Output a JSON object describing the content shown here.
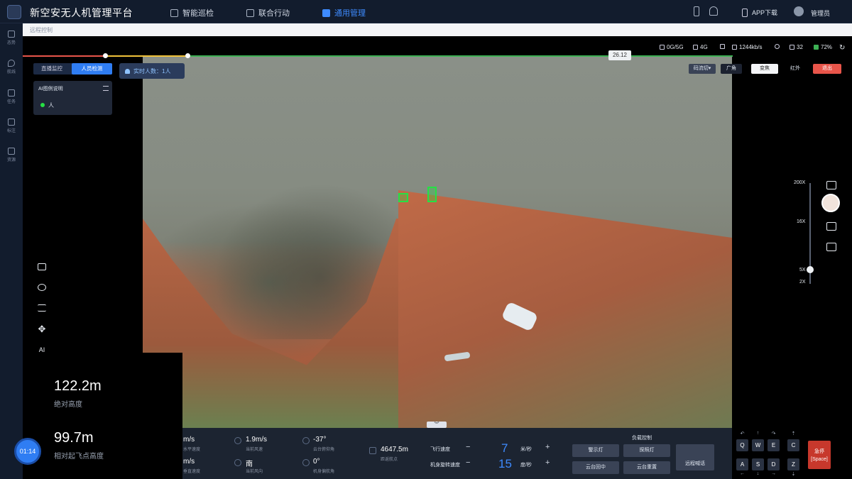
{
  "app": {
    "title": "新空安无人机管理平台"
  },
  "nav": {
    "items": [
      {
        "label": "智能巡检"
      },
      {
        "label": "联合行动"
      },
      {
        "label": "通用管理"
      }
    ],
    "app_download": "APP下载",
    "user": "管理员"
  },
  "breadcrumb": "远程控制",
  "sidebar": {
    "items": [
      {
        "label": "态势"
      },
      {
        "label": "航线"
      },
      {
        "label": "任务"
      },
      {
        "label": "标注"
      },
      {
        "label": "资源"
      }
    ]
  },
  "playback": {
    "time_tip": "26.12",
    "progress_fraction": 0.22
  },
  "overlay": {
    "tabs": [
      {
        "label": "直播监控"
      },
      {
        "label": "人员检测"
      }
    ],
    "person_count": "实时人数：1人",
    "legend": {
      "title": "AI图例说明",
      "items": [
        {
          "label": "人",
          "color": "#26e044"
        }
      ]
    }
  },
  "toolbar": {
    "ai_label": "AI"
  },
  "altitude": {
    "absolute_value": "122.2m",
    "absolute_label": "绝对高度",
    "relative_value": "99.7m",
    "relative_label": "相对起飞点高度",
    "clock": "01:14"
  },
  "telemetry": {
    "h_speed": {
      "value": "m/s",
      "label": "水平速度"
    },
    "v_speed": {
      "value": "m/s",
      "label": "垂直速度"
    },
    "wind_speed": {
      "value": "1.9m/s",
      "label": "当前风速"
    },
    "wind_dir": {
      "value": "南",
      "label": "当前风向"
    },
    "gimbal_pitch": {
      "value": "-37°",
      "label": "云台俯仰角"
    },
    "heading": {
      "value": "0°",
      "label": "机身偏航角"
    },
    "distance": {
      "value": "4647.5m",
      "label": "距返航点"
    },
    "flight_speed": {
      "label": "飞行速度",
      "value": "7",
      "unit": "米/秒"
    },
    "rotate_speed": {
      "label": "机身旋转速度",
      "value": "15",
      "unit": "度/秒"
    },
    "payload_title": "负载控制",
    "actions": [
      {
        "label": "警示灯"
      },
      {
        "label": "探照灯"
      },
      {
        "label": "云台回中"
      },
      {
        "label": "云台重置"
      }
    ],
    "shout": "远程喊话"
  },
  "status": {
    "network": "0G/5G",
    "cell": "4G",
    "rate": "1244kb/s",
    "satellites": "32",
    "battery": "72%"
  },
  "camera": {
    "buttons": [
      {
        "label": "码流切▾"
      },
      {
        "label": "广角"
      },
      {
        "label": "变焦"
      },
      {
        "label": "红外"
      },
      {
        "label": "退出"
      }
    ]
  },
  "zoom": {
    "labels": [
      "200X",
      "16X",
      "5X",
      "2X"
    ],
    "level": "5X"
  },
  "keyboard": {
    "keys": [
      "Q",
      "W",
      "E",
      "C",
      "A",
      "S",
      "D",
      "Z"
    ],
    "hover_label": "急停",
    "hover_key": "[Space]"
  },
  "colors": {
    "accent": "#2f7df3",
    "detection": "#26e044",
    "danger": "#c7382c"
  }
}
